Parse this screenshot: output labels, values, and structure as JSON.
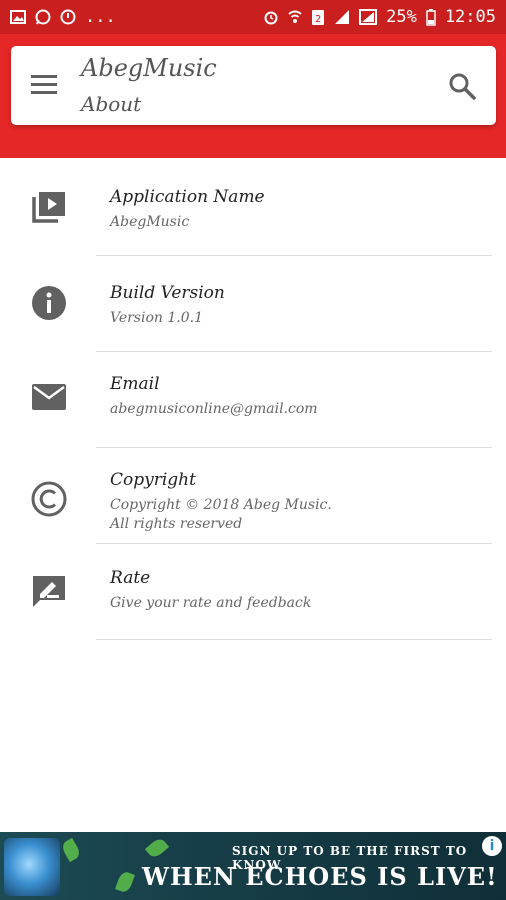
{
  "status_bar": {
    "battery": "25%",
    "time": "12:05",
    "ellipsis": "..."
  },
  "toolbar": {
    "title": "AbegMusic",
    "subtitle": "About"
  },
  "items": [
    {
      "label": "Application Name",
      "value": "AbegMusic",
      "icon": "video-library-icon"
    },
    {
      "label": "Build Version",
      "value": "Version 1.0.1",
      "icon": "info-icon"
    },
    {
      "label": "Email",
      "value": "abegmusiconline@gmail.com",
      "icon": "mail-icon"
    },
    {
      "label": "Copyright",
      "value": "Copyright © 2018 Abeg Music.\n All rights reserved",
      "icon": "copyright-icon"
    },
    {
      "label": "Rate",
      "value": "Give your rate and feedback",
      "icon": "rate-feedback-icon"
    }
  ],
  "ad": {
    "line1": "SIGN UP TO BE THE FIRST TO KNOW",
    "line2": "WHEN ECHOES IS LIVE!",
    "info_glyph": "i"
  },
  "colors": {
    "primary": "#e62727",
    "status_bar": "#c91f1f",
    "icon_gray": "#616161"
  }
}
